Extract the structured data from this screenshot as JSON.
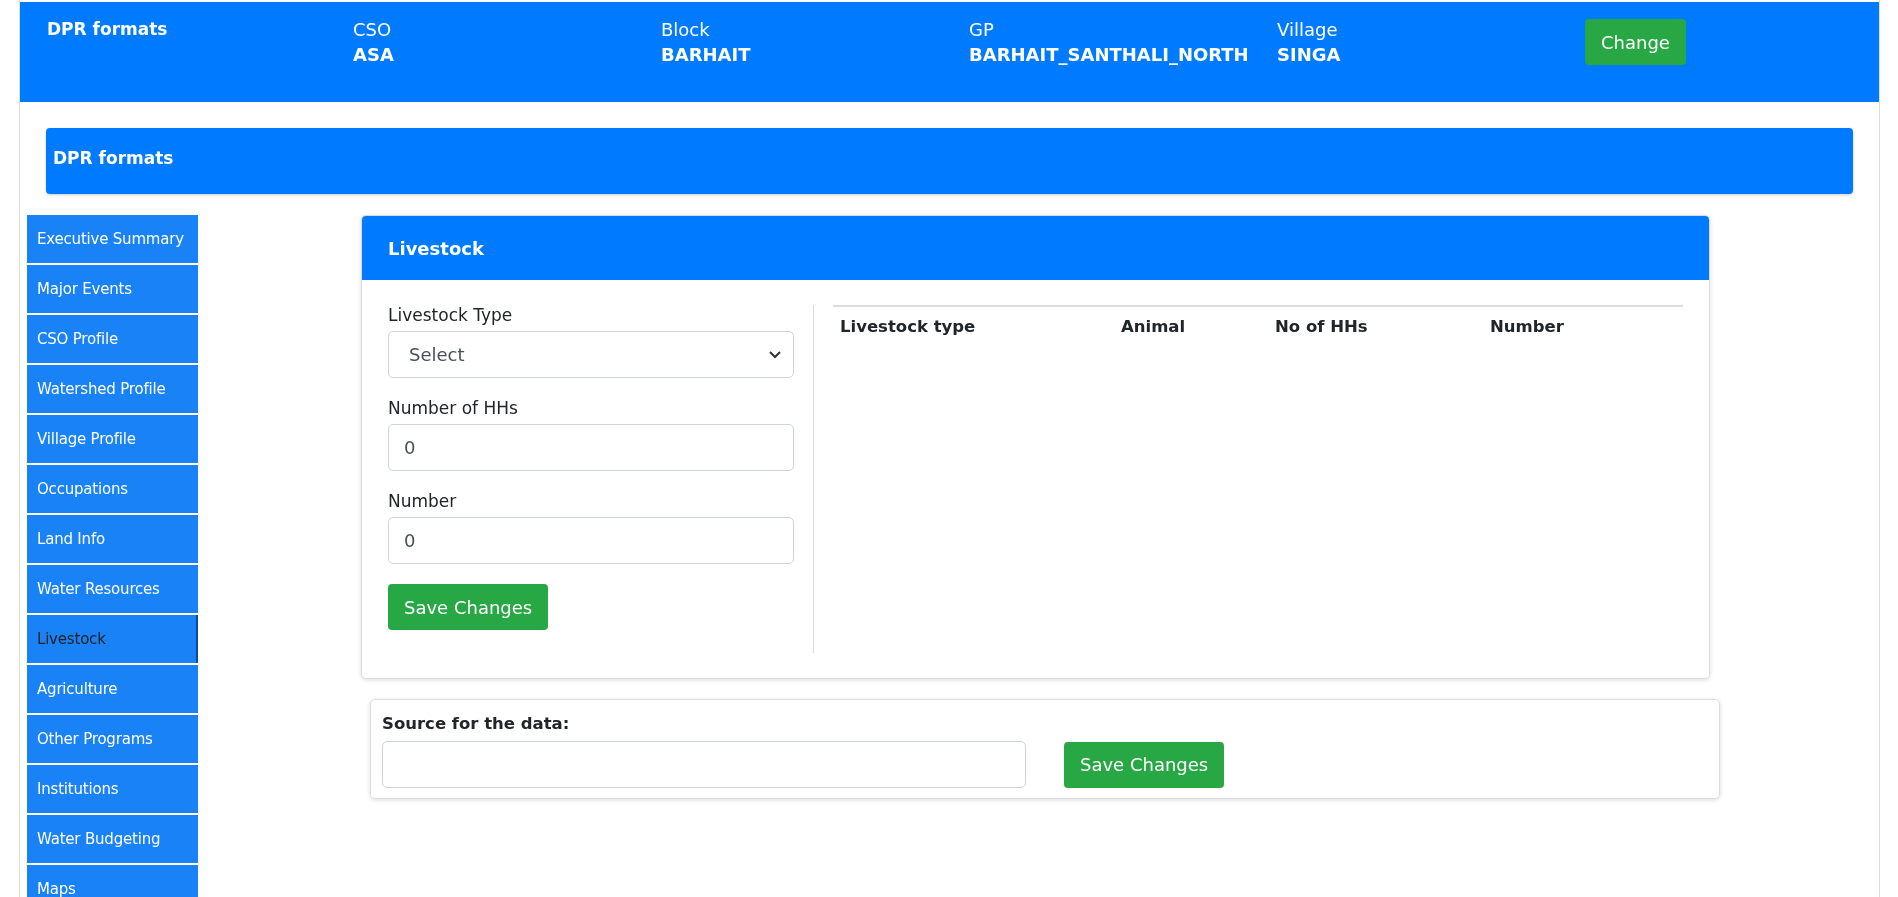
{
  "header": {
    "title": "DPR formats",
    "fields": [
      {
        "label": "CSO",
        "value": "ASA"
      },
      {
        "label": "Block",
        "value": "BARHAIT"
      },
      {
        "label": "GP",
        "value": "BARHAIT_SANTHALI_NORTH"
      },
      {
        "label": "Village",
        "value": "SINGA"
      }
    ],
    "button": "Change"
  },
  "section_title": "DPR formats",
  "sidebar": {
    "items": [
      {
        "label": "Executive Summary",
        "selected": false
      },
      {
        "label": "Major Events",
        "selected": false
      },
      {
        "label": "CSO Profile",
        "selected": false
      },
      {
        "label": "Watershed Profile",
        "selected": false
      },
      {
        "label": "Village Profile",
        "selected": false
      },
      {
        "label": "Occupations",
        "selected": false
      },
      {
        "label": "Land Info",
        "selected": false
      },
      {
        "label": "Water Resources",
        "selected": false
      },
      {
        "label": "Livestock",
        "selected": true
      },
      {
        "label": "Agriculture",
        "selected": false
      },
      {
        "label": "Other Programs",
        "selected": false
      },
      {
        "label": "Institutions",
        "selected": false
      },
      {
        "label": "Water Budgeting",
        "selected": false
      },
      {
        "label": "Maps",
        "selected": false
      }
    ]
  },
  "card": {
    "title": "Livestock",
    "form": [
      {
        "kind": "select",
        "label": "Livestock Type",
        "value": "Select"
      },
      {
        "kind": "input",
        "label": "Number of HHs",
        "value": "0"
      },
      {
        "kind": "input",
        "label": "Number",
        "value": "0"
      }
    ],
    "save_button": "Save Changes",
    "table": {
      "columns": [
        "Livestock type",
        "Animal",
        "No of HHs",
        "Number"
      ]
    }
  },
  "source": {
    "label": "Source for the data:",
    "save_button": "Save Changes"
  }
}
